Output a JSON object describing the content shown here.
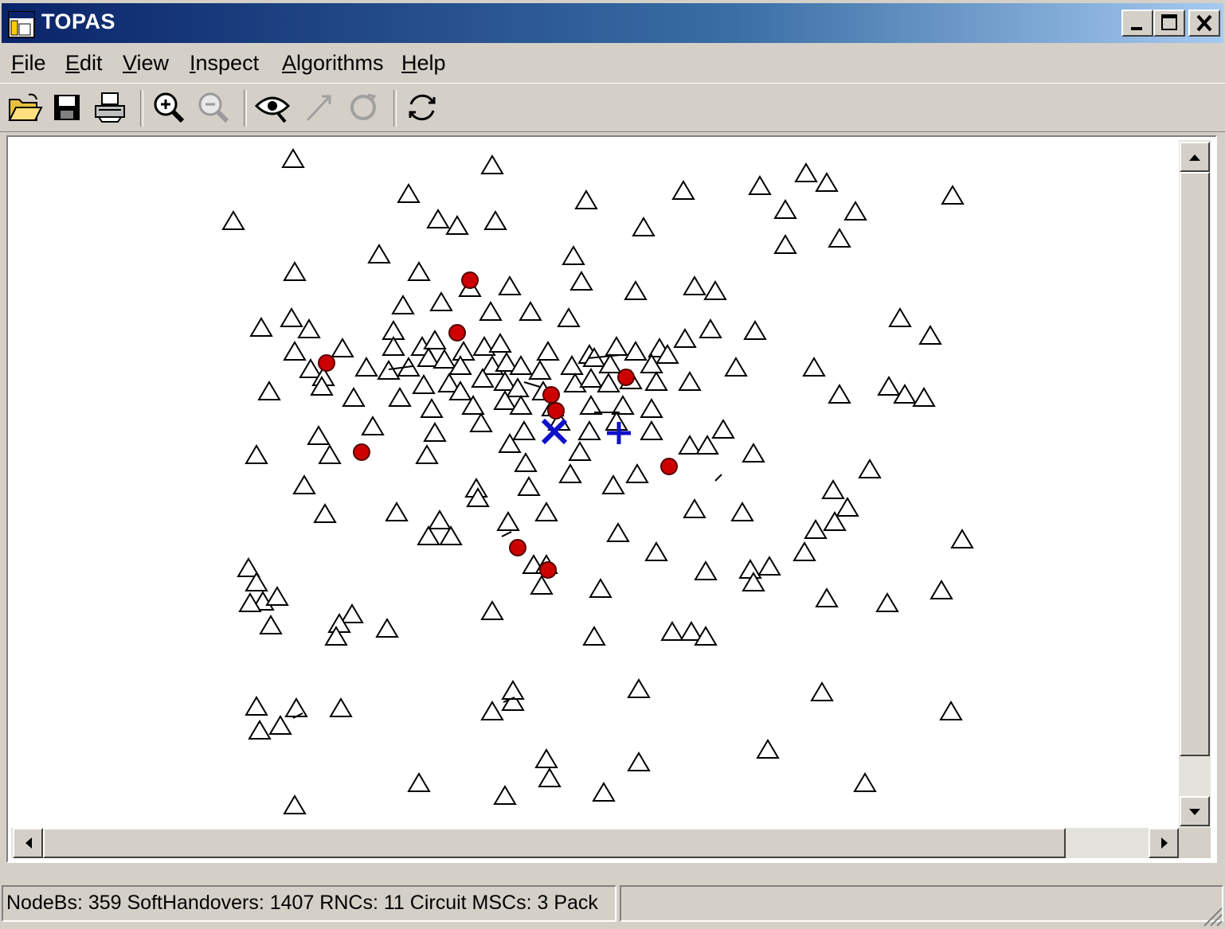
{
  "window": {
    "title": "TOPAS"
  },
  "menu": [
    {
      "pre": "",
      "u": "F",
      "post": "ile"
    },
    {
      "pre": "",
      "u": "E",
      "post": "dit"
    },
    {
      "pre": "",
      "u": "V",
      "post": "iew"
    },
    {
      "pre": "",
      "u": "I",
      "post": "nspect"
    },
    {
      "pre": "",
      "u": "A",
      "post": "lgorithms"
    },
    {
      "pre": "",
      "u": "H",
      "post": "elp"
    }
  ],
  "toolbar": [
    "open-folder-icon",
    "save-icon",
    "print-icon",
    "zoom-in-icon",
    "zoom-out-icon",
    "inspect-eye-icon",
    "arrow-icon",
    "rotate-icon",
    "refresh-icon"
  ],
  "status": {
    "text": "NodeBs: 359 SoftHandovers: 1407 RNCs: 11 Circuit MSCs: 3 Pack"
  },
  "colors": {
    "rnc": "#cc0000",
    "msc": "#1010cc",
    "title_start": "#0a246a",
    "title_end": "#a6caf0"
  }
}
